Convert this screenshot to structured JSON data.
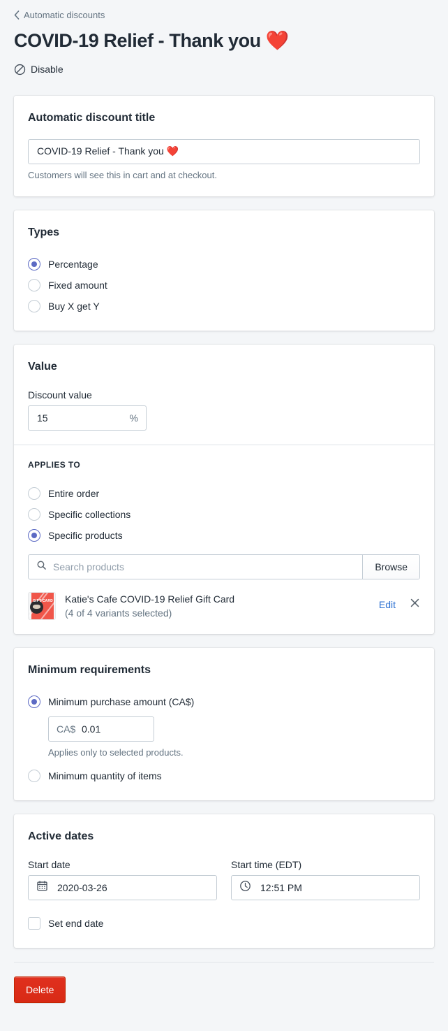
{
  "header": {
    "breadcrumb_label": "Automatic discounts",
    "back_icon": "chevron-left-icon",
    "title": "COVID-19 Relief - Thank you ❤️",
    "disable_label": "Disable",
    "disable_icon": "prohibition-icon"
  },
  "title_card": {
    "heading": "Automatic discount title",
    "input_value": "COVID-19 Relief - Thank you ❤️",
    "input_placeholder": "",
    "help_text": "Customers will see this in cart and at checkout."
  },
  "types_card": {
    "heading": "Types",
    "options": [
      {
        "label": "Percentage",
        "selected": true
      },
      {
        "label": "Fixed amount",
        "selected": false
      },
      {
        "label": "Buy X get Y",
        "selected": false
      }
    ]
  },
  "value_card": {
    "heading": "Value",
    "discount_value_label": "Discount value",
    "discount_value": "15",
    "discount_suffix": "%",
    "applies_to_heading": "APPLIES TO",
    "applies_to_options": [
      {
        "label": "Entire order",
        "selected": false
      },
      {
        "label": "Specific collections",
        "selected": false
      },
      {
        "label": "Specific products",
        "selected": true
      }
    ],
    "search_placeholder": "Search products",
    "search_value": "",
    "search_icon": "search-icon",
    "browse_label": "Browse",
    "selected_product": {
      "thumbnail_alt": "gift-card-thumbnail",
      "thumbnail_color": "#f0564a",
      "thumbnail_text": "GIFT CARD",
      "name": "Katie's Cafe COVID-19 Relief Gift Card",
      "variants": "(4 of 4 variants selected)",
      "edit_label": "Edit",
      "remove_icon": "close-icon"
    }
  },
  "minimum_card": {
    "heading": "Minimum requirements",
    "options": [
      {
        "label": "Minimum purchase amount (CA$)",
        "selected": true
      },
      {
        "label": "Minimum quantity of items",
        "selected": false
      }
    ],
    "amount_prefix": "CA$",
    "amount_value": "0.01",
    "amount_help": "Applies only to selected products."
  },
  "dates_card": {
    "heading": "Active dates",
    "start_date_label": "Start date",
    "start_date_value": "2020-03-26",
    "calendar_icon": "calendar-icon",
    "start_time_label": "Start time (EDT)",
    "start_time_value": "12:51 PM",
    "clock_icon": "clock-icon",
    "set_end_date_label": "Set end date",
    "set_end_date_checked": false
  },
  "footer": {
    "delete_label": "Delete"
  },
  "colors": {
    "page_bg": "#f4f6f8",
    "card_bg": "#ffffff",
    "text": "#212b36",
    "subdued_text": "#637381",
    "accent_radio": "#5c6ac4",
    "link": "#2e72d2",
    "destructive": "#e0301e",
    "border": "#c4cdd5"
  }
}
